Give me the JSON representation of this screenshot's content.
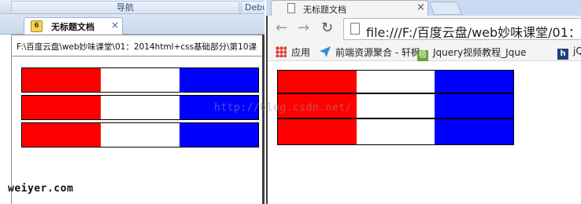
{
  "editor": {
    "topbar": {
      "nav_label": "导航",
      "debug_label": "Debu"
    },
    "tab": {
      "icon_label": "6",
      "title": "无标题文档",
      "close": "×"
    },
    "path": "F:\\百度云盘\\web妙味课堂\\01：2014html+css基础部分\\第10课"
  },
  "browser": {
    "tab": {
      "title": "无标题文档",
      "close": "×"
    },
    "nav": {
      "back": "←",
      "forward": "→",
      "reload": "↻"
    },
    "address": "file:///F:/百度云盘/web妙味课堂/01：",
    "bookmarks": [
      {
        "label": "应用",
        "icon": "apps-icon"
      },
      {
        "label": "前端资源聚合 - 轩枫",
        "icon": "telegram-icon"
      },
      {
        "label": "Jquery视频教程_Jque",
        "icon_text": "极",
        "icon": "jquery-icon"
      },
      {
        "label": "jQ",
        "icon_text": "h",
        "icon": "h-icon"
      }
    ]
  },
  "flag_colors": [
    "#ff0000",
    "#ffffff",
    "#0000ff"
  ],
  "watermarks": {
    "csdn": "http://blog.csdn.net/",
    "weiyer": "weiyer.com"
  }
}
